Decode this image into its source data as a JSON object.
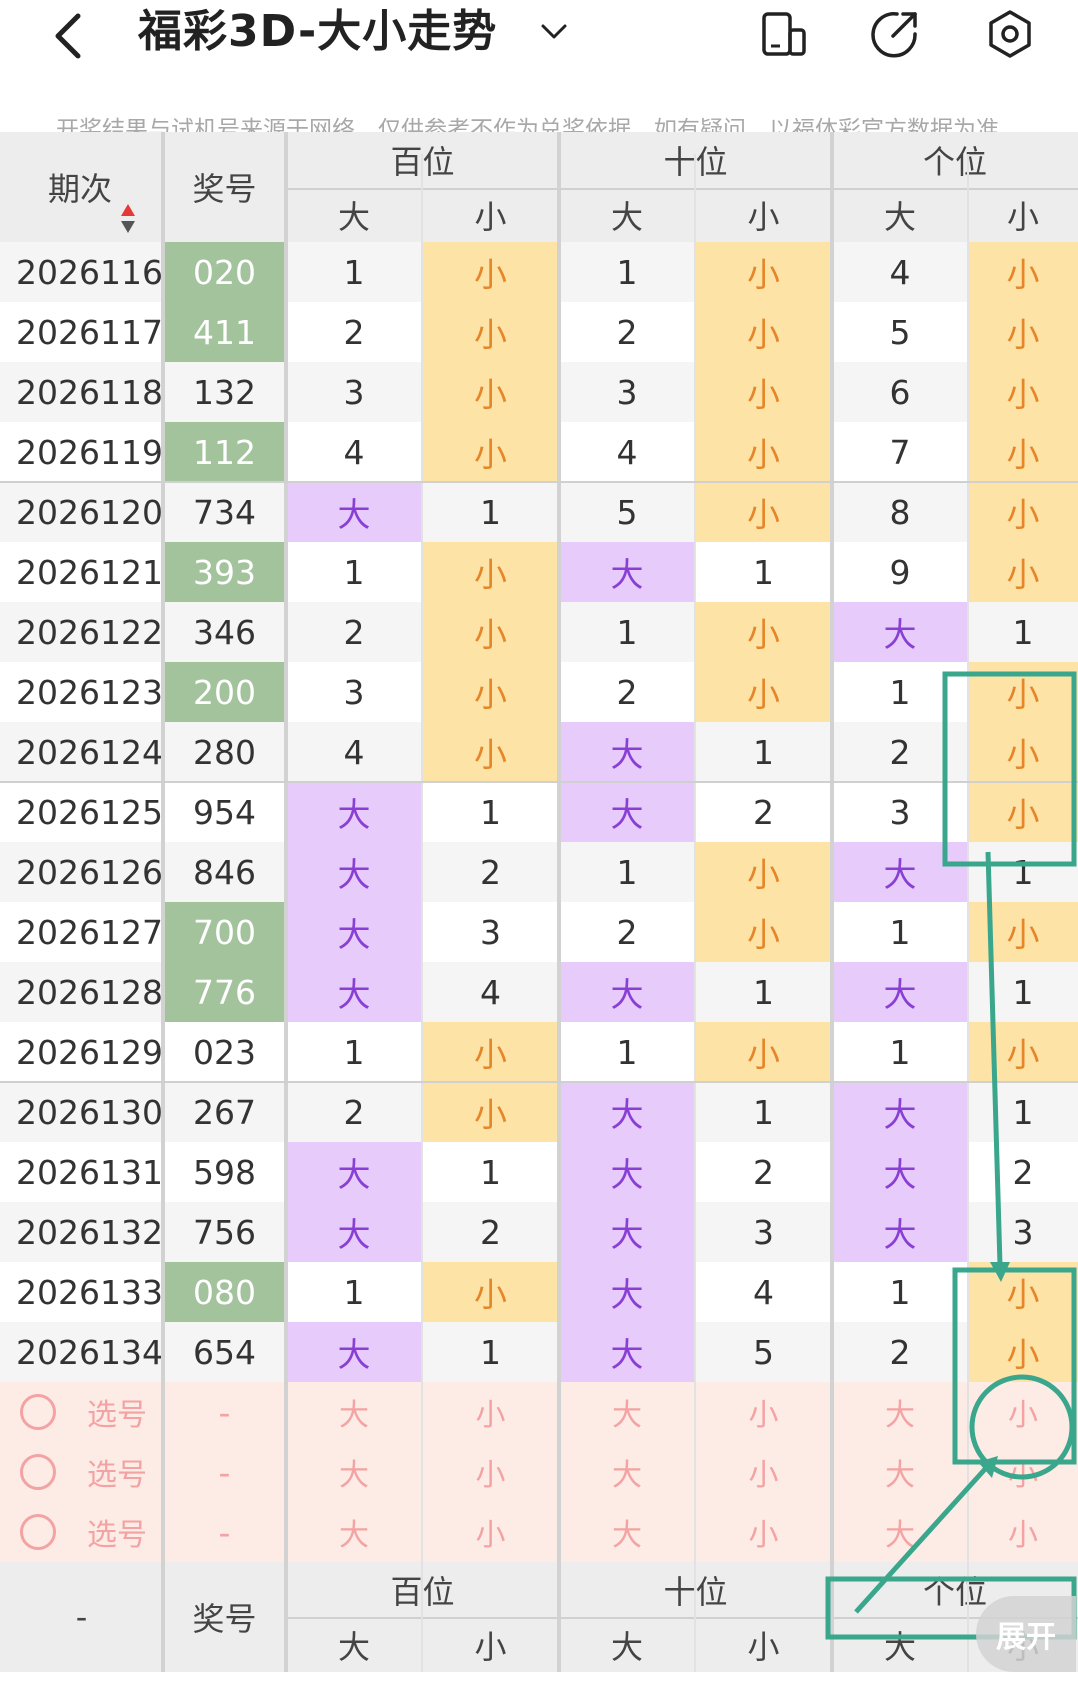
{
  "header": {
    "title": "福彩3D-大小走势",
    "icons": [
      "back-icon",
      "chevron-down-icon",
      "phone-split-icon",
      "share-icon",
      "settings-icon"
    ]
  },
  "notice": "开奖结果与试机号来源于网络，仅供参考不作为兑奖依据。如有疑问，以福体彩官方数据为准。",
  "table": {
    "col_period": "期次",
    "col_number": "奖号",
    "groups": [
      "百位",
      "十位",
      "个位"
    ],
    "sub": [
      "大",
      "小"
    ],
    "rows": [
      {
        "period": "2026116",
        "number": "020",
        "hl": true,
        "cells": [
          "1",
          "小",
          "1",
          "小",
          "4",
          "小"
        ]
      },
      {
        "period": "2026117",
        "number": "411",
        "hl": true,
        "cells": [
          "2",
          "小",
          "2",
          "小",
          "5",
          "小"
        ]
      },
      {
        "period": "2026118",
        "number": "132",
        "hl": false,
        "cells": [
          "3",
          "小",
          "3",
          "小",
          "6",
          "小"
        ]
      },
      {
        "period": "2026119",
        "number": "112",
        "hl": true,
        "cells": [
          "4",
          "小",
          "4",
          "小",
          "7",
          "小"
        ]
      },
      {
        "period": "2026120",
        "number": "734",
        "hl": false,
        "cells": [
          "大",
          "1",
          "5",
          "小",
          "8",
          "小"
        ]
      },
      {
        "period": "2026121",
        "number": "393",
        "hl": true,
        "cells": [
          "1",
          "小",
          "大",
          "1",
          "9",
          "小"
        ]
      },
      {
        "period": "2026122",
        "number": "346",
        "hl": false,
        "cells": [
          "2",
          "小",
          "1",
          "小",
          "大",
          "1"
        ]
      },
      {
        "period": "2026123",
        "number": "200",
        "hl": true,
        "cells": [
          "3",
          "小",
          "2",
          "小",
          "1",
          "小"
        ]
      },
      {
        "period": "2026124",
        "number": "280",
        "hl": false,
        "cells": [
          "4",
          "小",
          "大",
          "1",
          "2",
          "小"
        ]
      },
      {
        "period": "2026125",
        "number": "954",
        "hl": false,
        "cells": [
          "大",
          "1",
          "大",
          "2",
          "3",
          "小"
        ]
      },
      {
        "period": "2026126",
        "number": "846",
        "hl": false,
        "cells": [
          "大",
          "2",
          "1",
          "小",
          "大",
          "1"
        ]
      },
      {
        "period": "2026127",
        "number": "700",
        "hl": true,
        "cells": [
          "大",
          "3",
          "2",
          "小",
          "1",
          "小"
        ]
      },
      {
        "period": "2026128",
        "number": "776",
        "hl": true,
        "cells": [
          "大",
          "4",
          "大",
          "1",
          "大",
          "1"
        ]
      },
      {
        "period": "2026129",
        "number": "023",
        "hl": false,
        "cells": [
          "1",
          "小",
          "1",
          "小",
          "1",
          "小"
        ]
      },
      {
        "period": "2026130",
        "number": "267",
        "hl": false,
        "cells": [
          "2",
          "小",
          "大",
          "1",
          "大",
          "1"
        ]
      },
      {
        "period": "2026131",
        "number": "598",
        "hl": false,
        "cells": [
          "大",
          "1",
          "大",
          "2",
          "大",
          "2"
        ]
      },
      {
        "period": "2026132",
        "number": "756",
        "hl": false,
        "cells": [
          "大",
          "2",
          "大",
          "3",
          "大",
          "3"
        ]
      },
      {
        "period": "2026133",
        "number": "080",
        "hl": true,
        "cells": [
          "1",
          "小",
          "大",
          "4",
          "1",
          "小"
        ]
      },
      {
        "period": "2026134",
        "number": "654",
        "hl": false,
        "cells": [
          "大",
          "1",
          "大",
          "5",
          "2",
          "小"
        ]
      }
    ],
    "pick_rows": [
      {
        "label": "选号",
        "number": "-"
      },
      {
        "label": "选号",
        "number": "-"
      },
      {
        "label": "选号",
        "number": "-"
      }
    ],
    "footer": {
      "period": "-",
      "number": "奖号"
    }
  },
  "expand_label": "展开",
  "colors": {
    "big_bg": "#e6cbfb",
    "big_text": "#8a3fd4",
    "small_bg": "#fde3a6",
    "small_text": "#e6862a",
    "number_hl_bg": "#a3c39d",
    "pick_bg": "#fdebe6",
    "pick_text": "#f3a3a3",
    "header_bg": "#ededed",
    "annotation": "#3aa68c"
  }
}
